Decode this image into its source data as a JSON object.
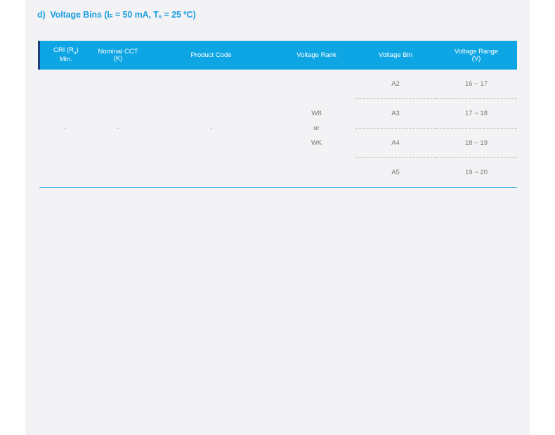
{
  "section": {
    "prefix": "d)",
    "title_main": "Voltage Bins (I",
    "title_sub1": "F",
    "title_mid": " = 50 mA, T",
    "title_sub2": "s",
    "title_end": " = 25 ºC)"
  },
  "table": {
    "headers": {
      "cri_main": "CRI (R",
      "cri_sub": "a",
      "cri_end": ")",
      "cri_line2": "Min.",
      "cct_line1": "Nominal CCT",
      "cct_line2": "(K)",
      "product_code": "Product Code",
      "voltage_rank": "Voltage Rank",
      "voltage_bin": "Voltage Bin",
      "range_line1": "Voltage Range",
      "range_line2": "(V)"
    },
    "cri_value": "-",
    "cct_value": "-",
    "product_code_value": "-",
    "rank_values": [
      "W8",
      "or",
      "WK"
    ],
    "rows": [
      {
        "bin": "A2",
        "range": "16 ~ 17"
      },
      {
        "bin": "A3",
        "range": "17 ~ 18"
      },
      {
        "bin": "A4",
        "range": "18 ~ 19"
      },
      {
        "bin": "A5",
        "range": "19 ~ 20"
      }
    ]
  }
}
